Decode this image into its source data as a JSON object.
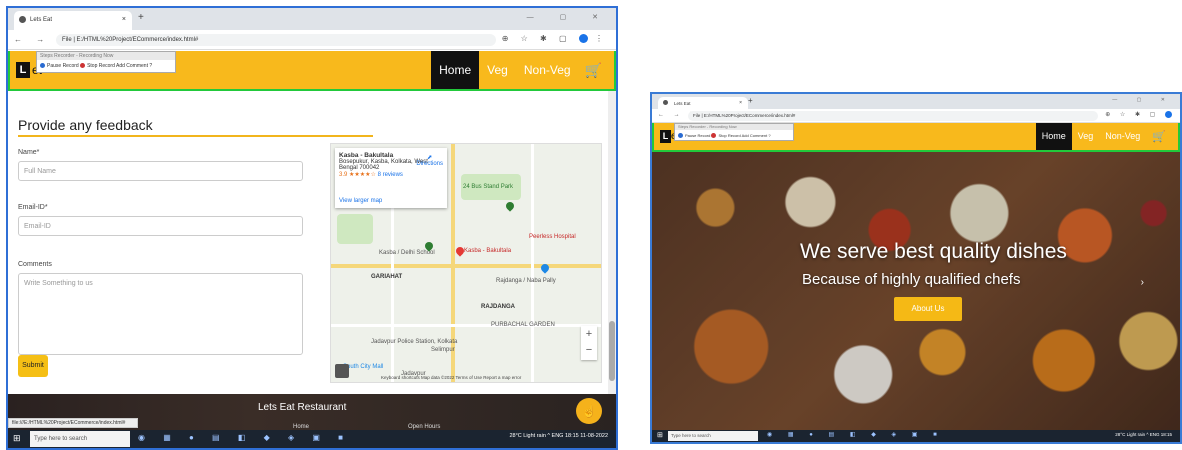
{
  "browser": {
    "tab_title": "Lets Eat",
    "new_tab": "+",
    "close_tab": "×",
    "window_controls": "— ▢ ✕",
    "nav_buttons": "← → C",
    "url": "File | E:/HTML%20Project/ECommerce/index.html#",
    "url_short": "File | E:/HTML%20Project/ECommerce/index.html#"
  },
  "recorder": {
    "title": "Steps Recorder - Recording Now",
    "pause": "Pause Record",
    "stop": "Stop Record",
    "add_comment": "Add Comment",
    "help": "?"
  },
  "site": {
    "logo_letter": "L",
    "logo_rest": "et",
    "nav": [
      {
        "label": "Home"
      },
      {
        "label": "Veg"
      },
      {
        "label": "Non-Veg"
      }
    ],
    "cart_icon": "🛒"
  },
  "feedback": {
    "title": "Provide any feedback",
    "name_label": "Name*",
    "name_placeholder": "Full Name",
    "email_label": "Email-ID*",
    "email_placeholder": "Email-ID",
    "comments_label": "Comments",
    "comments_placeholder": "Write Something to us",
    "submit": "Submit"
  },
  "map": {
    "place": "Kasba - Bakultala",
    "address": "Bosepukur, Kasba, Kolkata, West Bengal 700042",
    "rating": "3.9 ★★★★☆",
    "reviews": "8 reviews",
    "directions": "Directions",
    "larger_map": "View larger map",
    "labels": [
      "GARIAHAT",
      "Kasba - Bakultala",
      "Kasba / Delhi School",
      "RAJDANGA",
      "PURBACHAL GARDEN",
      "Jadavpur Police Station, Kolkata",
      "Selimpur",
      "24 Bus Stand Park",
      "Peerless Hospital",
      "Rajdanga / Naba Pally",
      "South City Mall",
      "Jadavpur"
    ],
    "zoom_in": "+",
    "zoom_out": "−",
    "footer": "Keyboard shortcuts   Map data ©2022   Terms of Use   Report a map error"
  },
  "footer": {
    "title": "Lets Eat Restaurant",
    "about": "About Us",
    "home": "Home",
    "hours": "Open Hours"
  },
  "status_url": "file:///E:/HTML%20Project/ECommerce/index.html#",
  "hero": {
    "headline": "We serve best quality dishes",
    "subheadline": "Because of highly qualified chefs",
    "button": "About Us",
    "next": "›"
  },
  "taskbar": {
    "search_placeholder": "Type here to search",
    "tray_text": "28°C Light rain  ^  ENG  18:15  11-08-2022",
    "tray_text_short": "28°C Light rain  ^  ENG  18:15"
  },
  "colors": {
    "brand": "#f8b91c",
    "active_nav": "#111111",
    "submit": "#f5bf15"
  }
}
